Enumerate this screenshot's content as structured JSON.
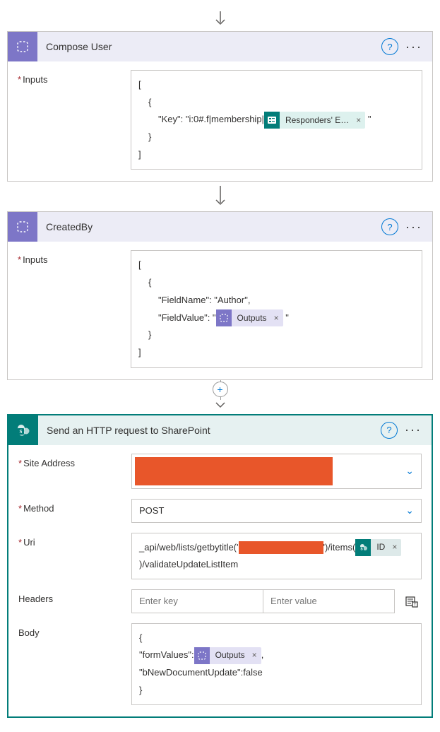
{
  "cards": {
    "compose_user": {
      "title": "Compose User",
      "inputs_label": "Inputs",
      "code": {
        "open_arr": "[",
        "open_obj": "{",
        "key_prefix": "\"Key\": \"i:0#.f|membership|",
        "token_label": "Responders' E…",
        "after_token": "\"",
        "close_obj": "}",
        "close_arr": "]"
      }
    },
    "created_by": {
      "title": "CreatedBy",
      "inputs_label": "Inputs",
      "code": {
        "open_arr": "[",
        "open_obj": "{",
        "line_fieldname": "\"FieldName\": \"Author\",",
        "fieldvalue_prefix": "\"FieldValue\": \"",
        "token_label": "Outputs",
        "after_token": "\"",
        "close_obj": "}",
        "close_arr": "]"
      }
    },
    "http": {
      "title": "Send an HTTP request to SharePoint",
      "labels": {
        "site": "Site Address",
        "method": "Method",
        "uri": "Uri",
        "headers": "Headers",
        "body": "Body"
      },
      "method_value": "POST",
      "uri": {
        "p1": "_api/web/lists/getbytitle('",
        "p2": "')/items(",
        "token_label": "ID",
        "p3": ")/validateUpdateListItem"
      },
      "headers": {
        "key_ph": "Enter key",
        "val_ph": "Enter value"
      },
      "body": {
        "open": "{",
        "line1_prefix": "\"formValues\":",
        "token_label": "Outputs",
        "line1_suffix": ",",
        "line2": "\"bNewDocumentUpdate\":false",
        "close": "}"
      }
    }
  }
}
